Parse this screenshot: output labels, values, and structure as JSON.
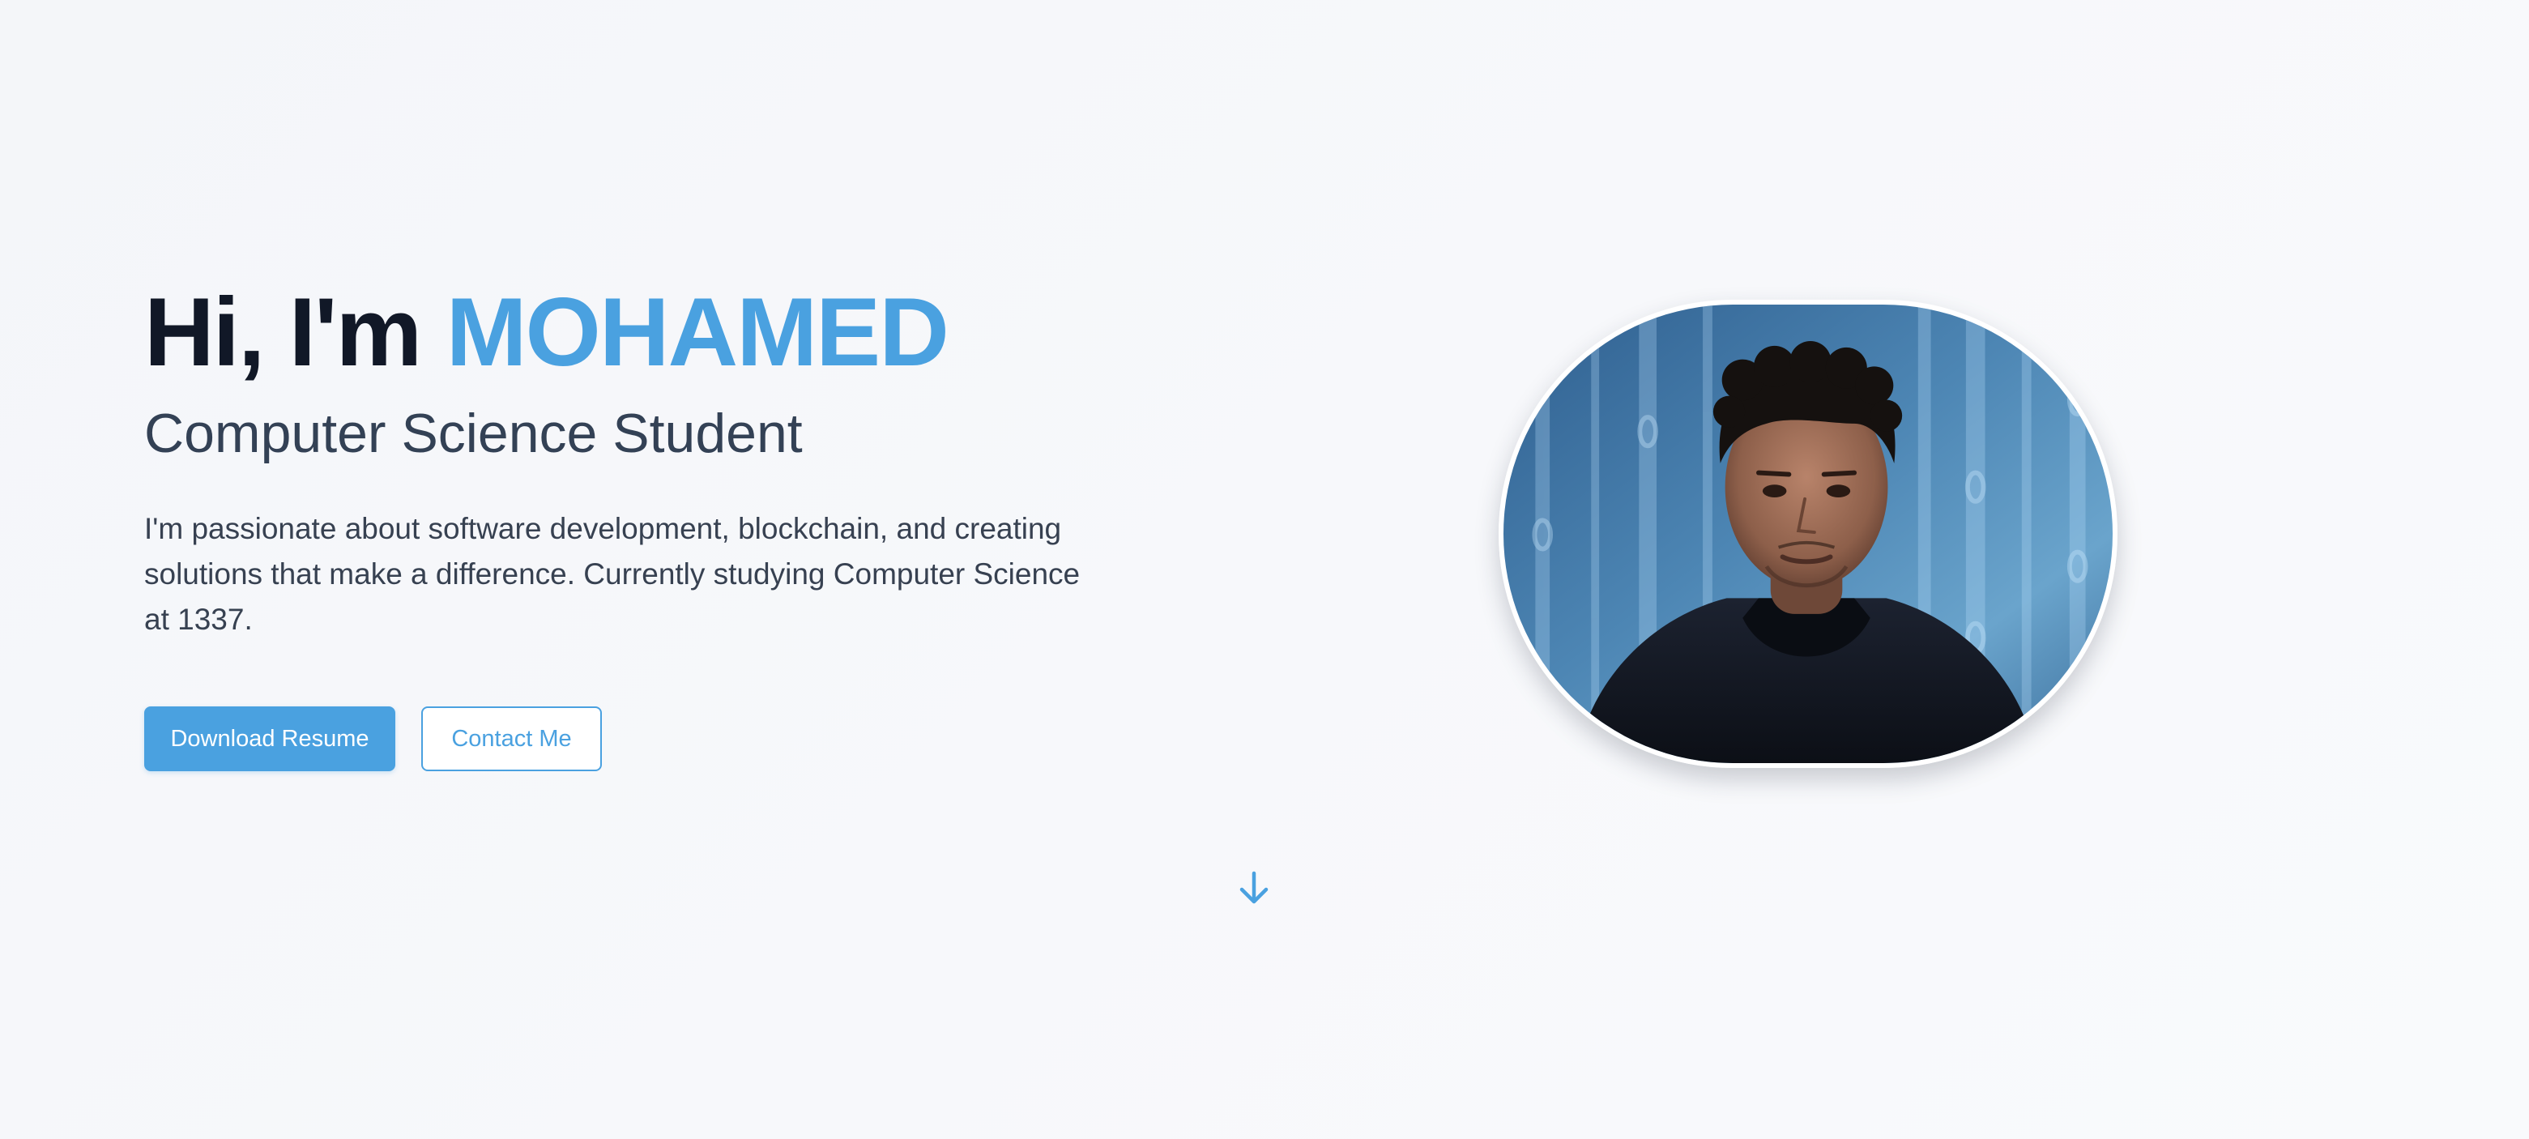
{
  "hero": {
    "greeting": "Hi, I'm ",
    "name": "MOHAMED",
    "subtitle": "Computer Science Student",
    "bio": "I'm passionate about software development, blockchain, and creating solutions that make a difference. Currently studying Computer Science at 1337.",
    "buttons": {
      "download_resume": "Download Resume",
      "contact_me": "Contact Me"
    },
    "portrait": {
      "alt": "Portrait photo of Mohamed"
    },
    "scroll_icon": "arrow-down-icon"
  },
  "colors": {
    "accent": "#4aa1e0",
    "heading": "#111827",
    "subtitle": "#334155",
    "body_text": "#374151",
    "background": "#f7f8fb"
  }
}
